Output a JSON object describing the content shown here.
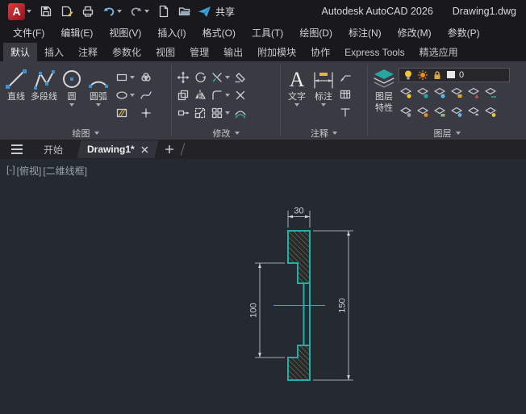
{
  "titlebar": {
    "app_title": "Autodesk AutoCAD 2026",
    "doc_title": "Drawing1.dwg",
    "share_label": "共享",
    "logo_glyph": "A"
  },
  "menubar": {
    "items": [
      "文件(F)",
      "编辑(E)",
      "视图(V)",
      "插入(I)",
      "格式(O)",
      "工具(T)",
      "绘图(D)",
      "标注(N)",
      "修改(M)",
      "参数(P)"
    ]
  },
  "ribbon": {
    "tabs": [
      "默认",
      "插入",
      "注释",
      "参数化",
      "视图",
      "管理",
      "输出",
      "附加模块",
      "协作",
      "Express Tools",
      "精选应用"
    ],
    "draw": {
      "label": "绘图",
      "line": "直线",
      "polyline": "多段线",
      "circle": "圆",
      "arc": "圆弧"
    },
    "modify": {
      "label": "修改"
    },
    "annotate": {
      "label": "注释",
      "text": "文字",
      "dimension": "标注",
      "text_icon_glyph": "A"
    },
    "layers": {
      "label": "图层",
      "properties_top": "图层",
      "properties_bottom": "特性",
      "current_layer": "0"
    }
  },
  "file_tabs": {
    "start": "开始",
    "active_drawing": "Drawing1*"
  },
  "viewport": {
    "controls": [
      "[-]",
      "[俯视]",
      "[二维线框]"
    ]
  },
  "drawing": {
    "dim_width": "30",
    "dim_notch": "100",
    "dim_height": "150"
  },
  "colors": {
    "accent_teal": "#1fb0a8",
    "hatch": "#8f7d35",
    "centerline": "#b8862b",
    "dimension": "#ced3d7",
    "canvas_bg": "#252a31",
    "logo_red": "#c41230",
    "share_blue": "#3fa9e0"
  }
}
